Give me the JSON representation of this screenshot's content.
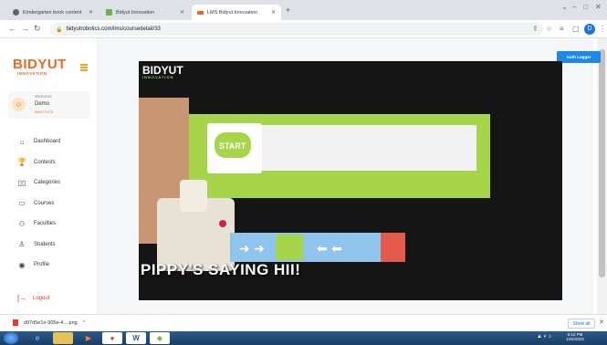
{
  "browser": {
    "tabs": [
      {
        "title": "Kindergarten book content",
        "fav_color": "#5f6368"
      },
      {
        "title": "Bidyut Innovation",
        "fav_color": "#6ab04c"
      },
      {
        "title": "LMS Bidyut Innovation",
        "fav_color": "#f26522"
      }
    ],
    "url": "bidyutrobotics.com/lms/coursedetail/33"
  },
  "sidebar": {
    "logo_big": "BIDYUT",
    "logo_small": "INNOVATION",
    "user": {
      "welcome": "Welcome",
      "name": "Demo",
      "role": "INSTITUTE"
    },
    "items": [
      {
        "label": "Dashboard",
        "icon": "home-icon"
      },
      {
        "label": "Contests",
        "icon": "trophy-icon"
      },
      {
        "label": "Categories",
        "icon": "book-icon"
      },
      {
        "label": "Courses",
        "icon": "monitor-icon"
      },
      {
        "label": "Faculties",
        "icon": "users-icon"
      },
      {
        "label": "Students",
        "icon": "user-icon"
      },
      {
        "label": "Profile",
        "icon": "profile-icon"
      }
    ],
    "logout": "Logout"
  },
  "main": {
    "auth_button": "Auth Logger",
    "video": {
      "caption": "PIPPY'S SAYING HII!",
      "watermark_top": "BIDYUT",
      "watermark_sub": "INNOVATION"
    }
  },
  "downloads": {
    "file": "d97d5e1e-905e-4....png",
    "show_all": "Show all"
  },
  "taskbar": {
    "time": "5:12 PM",
    "date": "12/6/2022"
  }
}
